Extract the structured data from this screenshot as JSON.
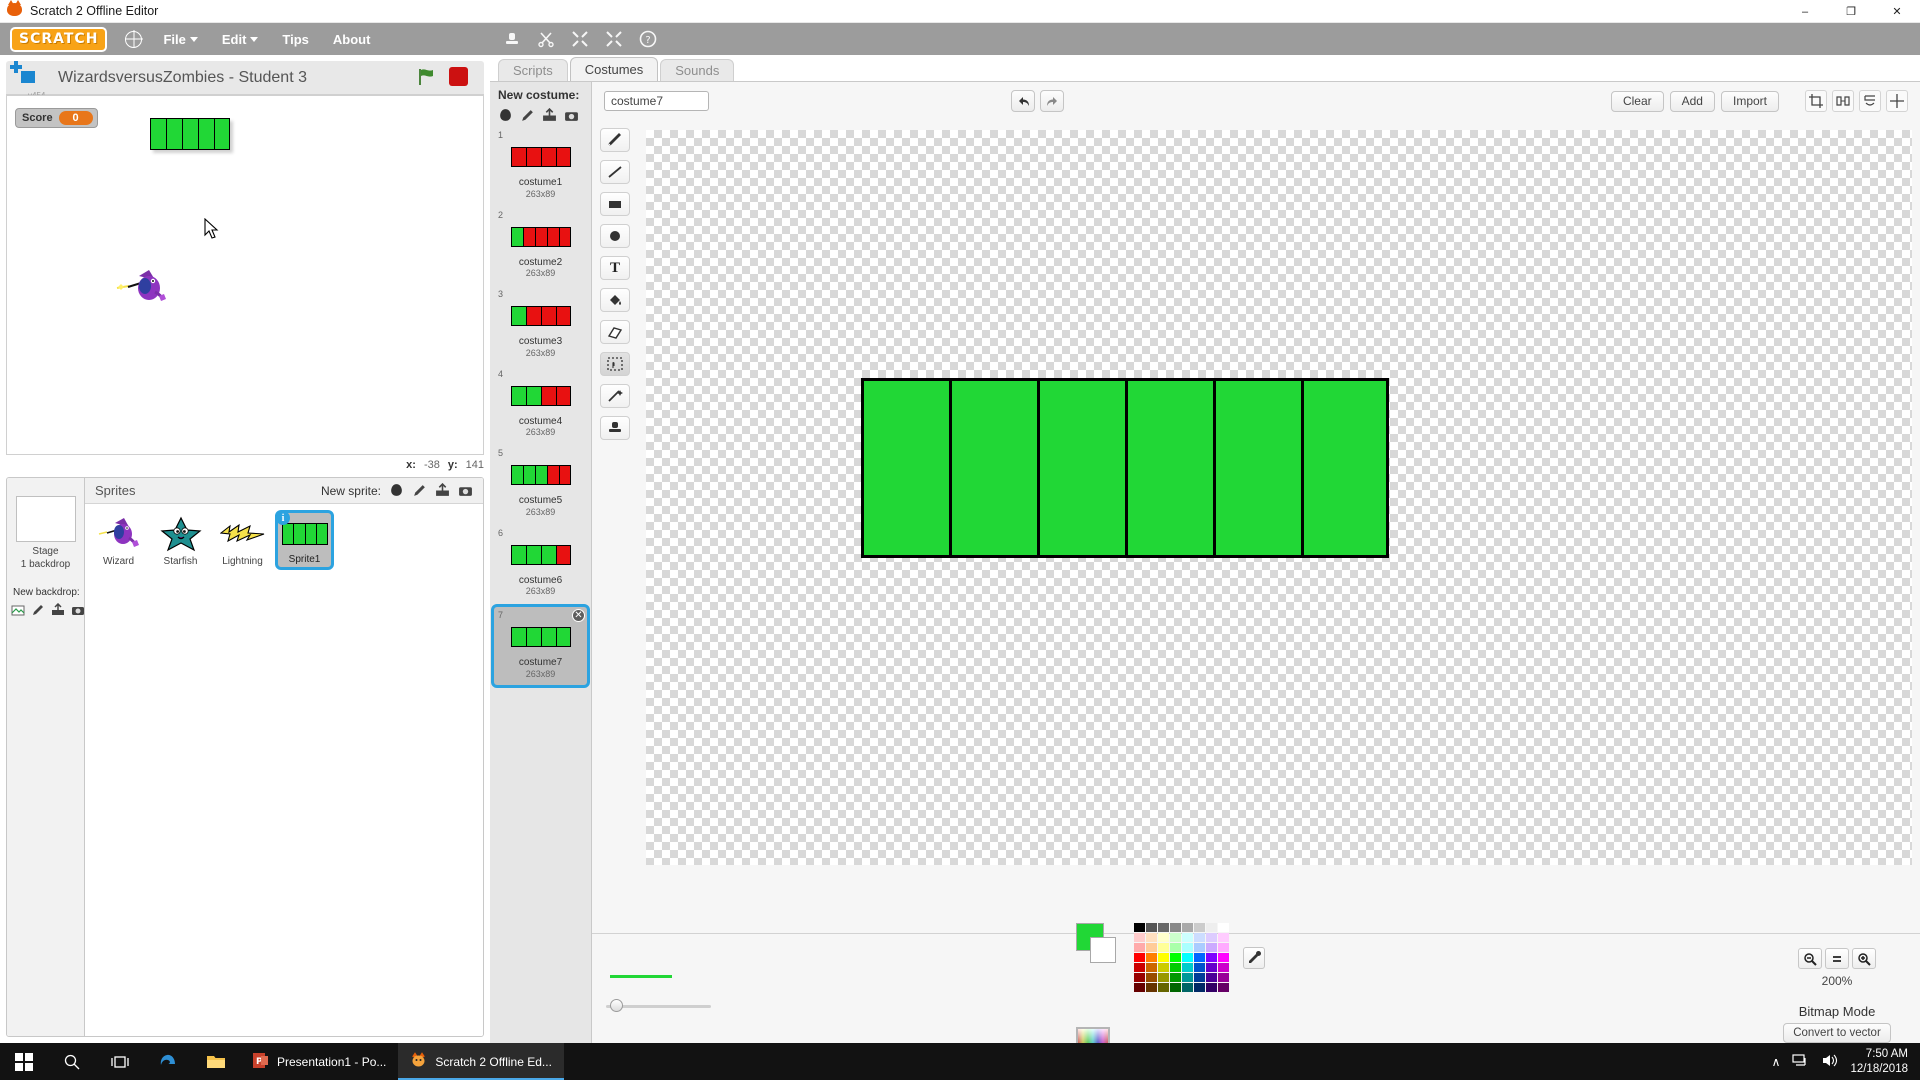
{
  "window": {
    "title": "Scratch 2 Offline Editor",
    "app_icon": "scratch-cat-icon",
    "controls": {
      "minimize": "–",
      "maximize": "❐",
      "close": "✕"
    }
  },
  "menubar": {
    "logo": "SCRATCH",
    "globe_icon": "globe-icon",
    "items": [
      {
        "label": "File",
        "has_caret": true
      },
      {
        "label": "Edit",
        "has_caret": true
      },
      {
        "label": "Tips",
        "has_caret": false
      },
      {
        "label": "About",
        "has_caret": false
      }
    ],
    "tools": [
      "stamp-icon",
      "scissors-icon",
      "grow-icon",
      "shrink-icon",
      "help-icon"
    ]
  },
  "stage": {
    "project_title": "WizardsversusZombies - Student 3",
    "version_label": "v454",
    "project_icon": "project-bracket-icon",
    "green_flag_icon": "green-flag-icon",
    "stop_icon": "stop-sign-icon",
    "watcher": {
      "label": "Score",
      "value": "0"
    },
    "sprite_bar_segments": 5,
    "wizard_sprite": "wizard-sprite",
    "cursor": "mouse-pointer-icon",
    "coords": {
      "x_label": "x:",
      "x_value": "-38",
      "y_label": "y:",
      "y_value": "141"
    }
  },
  "sprite_pane": {
    "stage_thumb": {
      "label": "Stage",
      "sublabel": "1 backdrop"
    },
    "new_backdrop_label": "New backdrop:",
    "new_backdrop_icons": [
      "library-icon",
      "paint-icon",
      "upload-icon",
      "camera-icon"
    ],
    "sprites_header": "Sprites",
    "new_sprite_label": "New sprite:",
    "new_sprite_icons": [
      "library-icon",
      "paint-icon",
      "upload-icon",
      "camera-icon"
    ],
    "sprites": [
      {
        "name": "Wizard",
        "selected": false,
        "art": "wizard"
      },
      {
        "name": "Starfish",
        "selected": false,
        "art": "starfish"
      },
      {
        "name": "Lightning",
        "selected": false,
        "art": "lightning"
      },
      {
        "name": "Sprite1",
        "selected": true,
        "art": "greenbar",
        "badge": "i"
      }
    ]
  },
  "tabs": [
    {
      "label": "Scripts",
      "active": false
    },
    {
      "label": "Costumes",
      "active": true
    },
    {
      "label": "Sounds",
      "active": false
    }
  ],
  "costume_panel": {
    "header": "New costume:",
    "header_icons": [
      "library-icon",
      "paint-icon",
      "upload-icon",
      "camera-icon"
    ],
    "costumes": [
      {
        "index": "1",
        "name": "costume1",
        "size": "263x89",
        "green": 0,
        "red": 4,
        "selected": false
      },
      {
        "index": "2",
        "name": "costume2",
        "size": "263x89",
        "green": 1,
        "red": 4,
        "selected": false
      },
      {
        "index": "3",
        "name": "costume3",
        "size": "263x89",
        "green": 1,
        "red": 3,
        "selected": false
      },
      {
        "index": "4",
        "name": "costume4",
        "size": "263x89",
        "green": 2,
        "red": 2,
        "selected": false
      },
      {
        "index": "5",
        "name": "costume5",
        "size": "263x89",
        "green": 3,
        "red": 2,
        "selected": false
      },
      {
        "index": "6",
        "name": "costume6",
        "size": "263x89",
        "green": 3,
        "red": 1,
        "selected": false
      },
      {
        "index": "7",
        "name": "costume7",
        "size": "263x89",
        "green": 4,
        "red": 0,
        "selected": true
      }
    ],
    "delete_icon": "close-icon"
  },
  "paint": {
    "costume_name_value": "costume7",
    "costume_name_placeholder": "costume7",
    "undo_icon": "undo-icon",
    "redo_icon": "redo-icon",
    "buttons": [
      {
        "label": "Clear"
      },
      {
        "label": "Add"
      },
      {
        "label": "Import"
      }
    ],
    "canvas_tools": [
      "crop-icon",
      "flip-horizontal-icon",
      "flip-vertical-icon",
      "set-center-icon"
    ],
    "tools": [
      {
        "name": "brush-icon",
        "active": false
      },
      {
        "name": "line-icon",
        "active": false
      },
      {
        "name": "rectangle-icon",
        "active": false
      },
      {
        "name": "ellipse-icon",
        "active": false
      },
      {
        "name": "text-icon",
        "active": false
      },
      {
        "name": "fill-icon",
        "active": false
      },
      {
        "name": "eraser-icon",
        "active": false
      },
      {
        "name": "select-icon",
        "active": true
      },
      {
        "name": "magic-wand-icon",
        "active": false
      },
      {
        "name": "stamp-icon",
        "active": false
      }
    ],
    "drawing": {
      "segments": 6,
      "fill_color": "#21d736",
      "stroke_color": "#000000"
    },
    "brush": {
      "preview_color": "#21d736",
      "slider_value": 5
    },
    "colors": {
      "fill": "#21d736",
      "stroke": "#ffffff",
      "spectrum_icon": "color-spectrum-icon",
      "eyedropper_icon": "eyedropper-icon",
      "palette": [
        [
          "#000000",
          "#555555",
          "#686868",
          "#888888",
          "#aaaaaa",
          "#cccccc",
          "#eeeeee",
          "#ffffff"
        ],
        [
          "#ffcccc",
          "#ffe0c0",
          "#ffffcc",
          "#ccffcc",
          "#ccffff",
          "#ccddff",
          "#ddccff",
          "#ffccff"
        ],
        [
          "#ffaaaa",
          "#ffcc99",
          "#ffff99",
          "#aaffaa",
          "#aaffff",
          "#aaccff",
          "#ccaaff",
          "#ffaaff"
        ],
        [
          "#ff0000",
          "#ff7f00",
          "#ffff00",
          "#00ff00",
          "#00ffff",
          "#0066ff",
          "#7f00ff",
          "#ff00ff"
        ],
        [
          "#cc0000",
          "#cc6600",
          "#cccc00",
          "#00cc00",
          "#00cccc",
          "#0052cc",
          "#6600cc",
          "#cc00cc"
        ],
        [
          "#990000",
          "#994c00",
          "#999900",
          "#009900",
          "#009999",
          "#003d99",
          "#4c0099",
          "#990099"
        ],
        [
          "#660000",
          "#663300",
          "#666600",
          "#006600",
          "#006666",
          "#002966",
          "#330066",
          "#660066"
        ]
      ]
    },
    "zoom": {
      "out_icon": "zoom-out-icon",
      "reset_icon": "zoom-reset-icon",
      "in_icon": "zoom-in-icon",
      "level": "200%"
    },
    "mode_label": "Bitmap Mode",
    "convert_label": "Convert to vector"
  },
  "taskbar": {
    "start_icon": "windows-start-icon",
    "search_icon": "search-icon",
    "taskview_icon": "task-view-icon",
    "pinned": [
      {
        "name": "edge-icon"
      },
      {
        "name": "file-explorer-icon"
      }
    ],
    "apps": [
      {
        "label": "Presentation1 - Po...",
        "icon": "powerpoint-icon",
        "active": false
      },
      {
        "label": "Scratch 2 Offline Ed...",
        "icon": "scratch-cat-icon",
        "active": true
      }
    ],
    "tray": {
      "chevron": "∧",
      "network_icon": "network-icon",
      "volume_icon": "volume-icon"
    },
    "clock": {
      "time": "7:50 AM",
      "date": "12/18/2018"
    }
  }
}
